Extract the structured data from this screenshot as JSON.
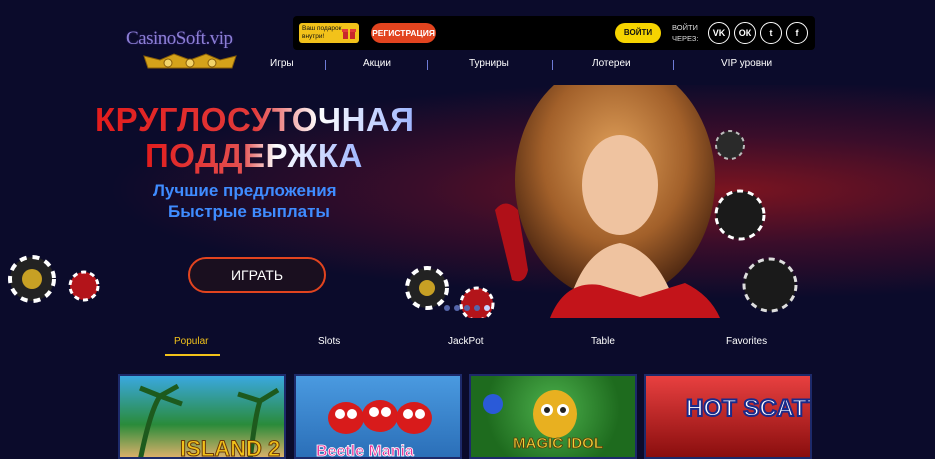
{
  "brand": {
    "logo_text": "CasinoSoft.vip"
  },
  "topbar": {
    "gift_text": "Ваш подарок внутри!",
    "register_label": "РЕГИСТРАЦИЯ",
    "login_label": "ВОЙТИ",
    "login_via": "ВОЙТИ ЧЕРЕЗ:",
    "socials": [
      {
        "label": "VK",
        "icon": "vk-icon"
      },
      {
        "label": "ОК",
        "icon": "odnoklassniki-icon"
      },
      {
        "label": "t",
        "icon": "twitter-icon"
      },
      {
        "label": "f",
        "icon": "facebook-icon"
      }
    ]
  },
  "nav": {
    "items": [
      {
        "label": "Игры"
      },
      {
        "label": "Акции"
      },
      {
        "label": "Турниры"
      },
      {
        "label": "Лотереи"
      },
      {
        "label": "VIP уровни"
      }
    ]
  },
  "hero": {
    "headline_line1": "КРУГЛОСУТОЧНАЯ",
    "headline_line2": "ПОДДЕРЖКА",
    "subline1": "Лучшие предложения",
    "subline2": "Быстрые выплаты",
    "play_label": "ИГРАТЬ",
    "slide_count": 5,
    "active_slide": 4
  },
  "tabs": {
    "items": [
      {
        "label": "Popular",
        "active": true
      },
      {
        "label": "Slots"
      },
      {
        "label": "JackPot"
      },
      {
        "label": "Table"
      },
      {
        "label": "Favorites"
      }
    ]
  },
  "games": [
    {
      "title": "ISLAND 2",
      "bg": "#2a8b3a"
    },
    {
      "title": "Beetle Mania",
      "bg": "#2b6fb8"
    },
    {
      "title": "MAGIC IDOL",
      "bg": "#1e6b1e"
    },
    {
      "title": "HOT SCATTER",
      "bg": "#b01818"
    }
  ],
  "colors": {
    "accent": "#e2441f",
    "gold": "#f2c21a",
    "background": "#0b0b2b",
    "link_blue": "#3f8cff"
  }
}
